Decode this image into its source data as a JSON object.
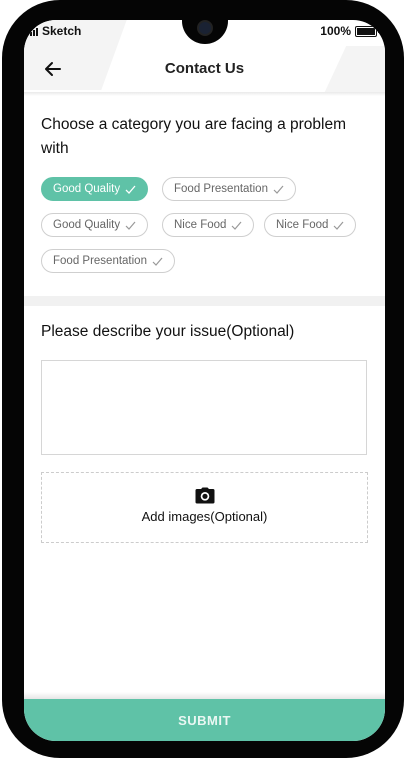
{
  "status_bar": {
    "carrier": "Sketch",
    "battery_percent": "100%"
  },
  "header": {
    "title": "Contact Us",
    "back_icon": "arrow-left-icon"
  },
  "category_section": {
    "title": "Choose a category you are facing a problem with",
    "chips": [
      {
        "label": "Good Quality",
        "selected": true
      },
      {
        "label": "Food Presentation",
        "selected": false
      },
      {
        "label": "Good Quality",
        "selected": false
      },
      {
        "label": "Nice Food",
        "selected": false
      },
      {
        "label": "Nice Food",
        "selected": false
      },
      {
        "label": "Food Presentation",
        "selected": false
      }
    ]
  },
  "issue_section": {
    "title": "Please describe your issue(Optional)",
    "value": "",
    "upload_label": "Add images(Optional)",
    "upload_icon": "camera-icon"
  },
  "footer": {
    "submit_label": "SUBMIT"
  },
  "colors": {
    "accent": "#5fc2a7",
    "chip_border": "#cfcfcf",
    "divider": "#f1f1f1"
  }
}
